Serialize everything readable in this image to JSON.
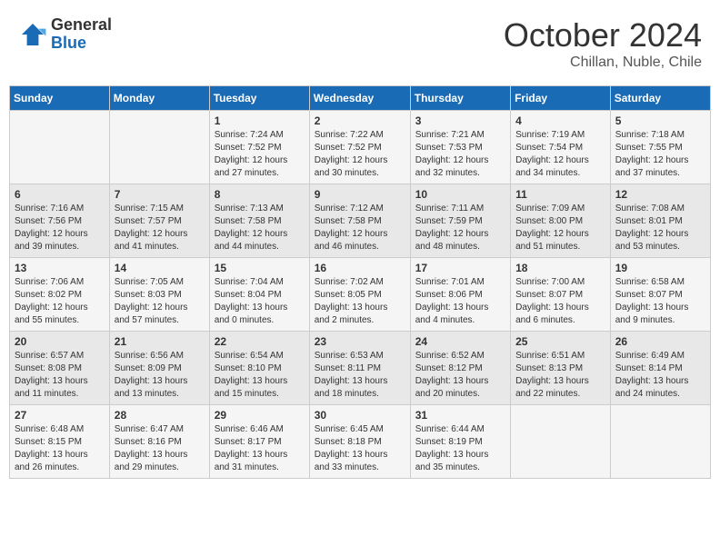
{
  "header": {
    "logo_general": "General",
    "logo_blue": "Blue",
    "month_title": "October 2024",
    "subtitle": "Chillan, Nuble, Chile"
  },
  "days_of_week": [
    "Sunday",
    "Monday",
    "Tuesday",
    "Wednesday",
    "Thursday",
    "Friday",
    "Saturday"
  ],
  "weeks": [
    [
      {
        "day": "",
        "info": ""
      },
      {
        "day": "",
        "info": ""
      },
      {
        "day": "1",
        "sunrise": "7:24 AM",
        "sunset": "7:52 PM",
        "daylight": "12 hours and 27 minutes"
      },
      {
        "day": "2",
        "sunrise": "7:22 AM",
        "sunset": "7:52 PM",
        "daylight": "12 hours and 30 minutes"
      },
      {
        "day": "3",
        "sunrise": "7:21 AM",
        "sunset": "7:53 PM",
        "daylight": "12 hours and 32 minutes"
      },
      {
        "day": "4",
        "sunrise": "7:19 AM",
        "sunset": "7:54 PM",
        "daylight": "12 hours and 34 minutes"
      },
      {
        "day": "5",
        "sunrise": "7:18 AM",
        "sunset": "7:55 PM",
        "daylight": "12 hours and 37 minutes"
      }
    ],
    [
      {
        "day": "6",
        "sunrise": "7:16 AM",
        "sunset": "7:56 PM",
        "daylight": "12 hours and 39 minutes"
      },
      {
        "day": "7",
        "sunrise": "7:15 AM",
        "sunset": "7:57 PM",
        "daylight": "12 hours and 41 minutes"
      },
      {
        "day": "8",
        "sunrise": "7:13 AM",
        "sunset": "7:58 PM",
        "daylight": "12 hours and 44 minutes"
      },
      {
        "day": "9",
        "sunrise": "7:12 AM",
        "sunset": "7:58 PM",
        "daylight": "12 hours and 46 minutes"
      },
      {
        "day": "10",
        "sunrise": "7:11 AM",
        "sunset": "7:59 PM",
        "daylight": "12 hours and 48 minutes"
      },
      {
        "day": "11",
        "sunrise": "7:09 AM",
        "sunset": "8:00 PM",
        "daylight": "12 hours and 51 minutes"
      },
      {
        "day": "12",
        "sunrise": "7:08 AM",
        "sunset": "8:01 PM",
        "daylight": "12 hours and 53 minutes"
      }
    ],
    [
      {
        "day": "13",
        "sunrise": "7:06 AM",
        "sunset": "8:02 PM",
        "daylight": "12 hours and 55 minutes"
      },
      {
        "day": "14",
        "sunrise": "7:05 AM",
        "sunset": "8:03 PM",
        "daylight": "12 hours and 57 minutes"
      },
      {
        "day": "15",
        "sunrise": "7:04 AM",
        "sunset": "8:04 PM",
        "daylight": "13 hours and 0 minutes"
      },
      {
        "day": "16",
        "sunrise": "7:02 AM",
        "sunset": "8:05 PM",
        "daylight": "13 hours and 2 minutes"
      },
      {
        "day": "17",
        "sunrise": "7:01 AM",
        "sunset": "8:06 PM",
        "daylight": "13 hours and 4 minutes"
      },
      {
        "day": "18",
        "sunrise": "7:00 AM",
        "sunset": "8:07 PM",
        "daylight": "13 hours and 6 minutes"
      },
      {
        "day": "19",
        "sunrise": "6:58 AM",
        "sunset": "8:07 PM",
        "daylight": "13 hours and 9 minutes"
      }
    ],
    [
      {
        "day": "20",
        "sunrise": "6:57 AM",
        "sunset": "8:08 PM",
        "daylight": "13 hours and 11 minutes"
      },
      {
        "day": "21",
        "sunrise": "6:56 AM",
        "sunset": "8:09 PM",
        "daylight": "13 hours and 13 minutes"
      },
      {
        "day": "22",
        "sunrise": "6:54 AM",
        "sunset": "8:10 PM",
        "daylight": "13 hours and 15 minutes"
      },
      {
        "day": "23",
        "sunrise": "6:53 AM",
        "sunset": "8:11 PM",
        "daylight": "13 hours and 18 minutes"
      },
      {
        "day": "24",
        "sunrise": "6:52 AM",
        "sunset": "8:12 PM",
        "daylight": "13 hours and 20 minutes"
      },
      {
        "day": "25",
        "sunrise": "6:51 AM",
        "sunset": "8:13 PM",
        "daylight": "13 hours and 22 minutes"
      },
      {
        "day": "26",
        "sunrise": "6:49 AM",
        "sunset": "8:14 PM",
        "daylight": "13 hours and 24 minutes"
      }
    ],
    [
      {
        "day": "27",
        "sunrise": "6:48 AM",
        "sunset": "8:15 PM",
        "daylight": "13 hours and 26 minutes"
      },
      {
        "day": "28",
        "sunrise": "6:47 AM",
        "sunset": "8:16 PM",
        "daylight": "13 hours and 29 minutes"
      },
      {
        "day": "29",
        "sunrise": "6:46 AM",
        "sunset": "8:17 PM",
        "daylight": "13 hours and 31 minutes"
      },
      {
        "day": "30",
        "sunrise": "6:45 AM",
        "sunset": "8:18 PM",
        "daylight": "13 hours and 33 minutes"
      },
      {
        "day": "31",
        "sunrise": "6:44 AM",
        "sunset": "8:19 PM",
        "daylight": "13 hours and 35 minutes"
      },
      {
        "day": "",
        "info": ""
      },
      {
        "day": "",
        "info": ""
      }
    ]
  ]
}
